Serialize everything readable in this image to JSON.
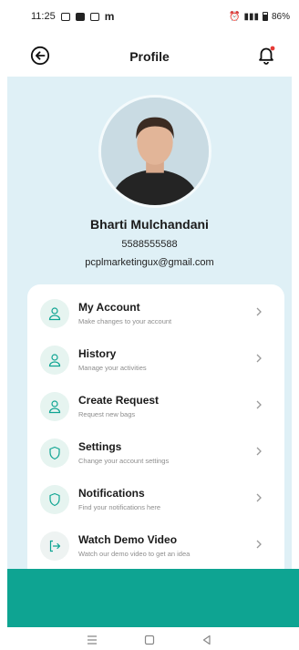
{
  "status_bar": {
    "time": "11:25",
    "app_letter": "m",
    "battery": "86%"
  },
  "header": {
    "title": "Profile",
    "back_icon": "back-arrow-circle-icon",
    "bell_icon": "bell-icon"
  },
  "colors": {
    "accent_teal": "#0ea492",
    "profile_background": "#dff0f6",
    "icon_circle": "#e6f4f0",
    "notification_dot": "#e53935"
  },
  "profile": {
    "name": "Bharti Mulchandani",
    "phone": "5588555588",
    "email": "pcplmarketingux@gmail.com"
  },
  "menu": [
    {
      "label": "My Account",
      "description": "Make changes to your account",
      "icon": "user-icon"
    },
    {
      "label": "History",
      "description": "Manage your activities",
      "icon": "user-icon"
    },
    {
      "label": "Create Request",
      "description": "Request new bags",
      "icon": "user-icon"
    },
    {
      "label": "Settings",
      "description": "Change your account settings",
      "icon": "shield-icon"
    },
    {
      "label": "Notifications",
      "description": "Find your notifications here",
      "icon": "shield-icon"
    },
    {
      "label": "Watch Demo Video",
      "description": "Watch our demo video to get an idea",
      "icon": "logout-icon"
    }
  ]
}
